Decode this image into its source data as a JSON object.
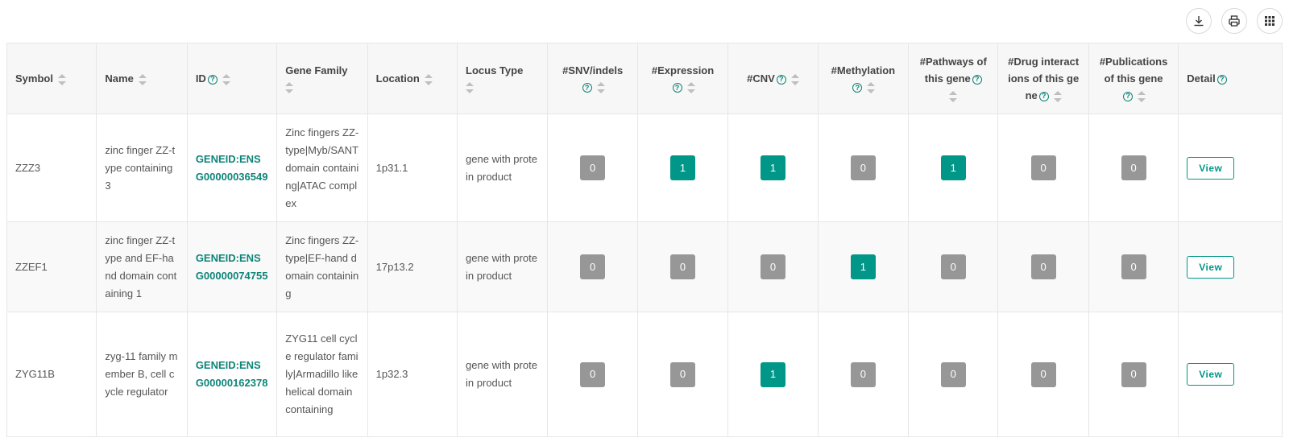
{
  "toolbar": {
    "buttons": [
      {
        "icon": "download-icon"
      },
      {
        "icon": "print-icon"
      },
      {
        "icon": "columns-grid-icon"
      }
    ]
  },
  "colors": {
    "accent": "#009688",
    "link": "#0e8478",
    "badge_zero": "#979797",
    "header_bg": "#f7f7f7"
  },
  "table": {
    "headers": [
      {
        "label": "Symbol",
        "help": false,
        "sortable": true
      },
      {
        "label": "Name",
        "help": false,
        "sortable": true
      },
      {
        "label": "ID",
        "help": true,
        "sortable": true
      },
      {
        "label": "Gene Family",
        "help": false,
        "sortable": true
      },
      {
        "label": "Location",
        "help": false,
        "sortable": true
      },
      {
        "label": "Locus Type",
        "help": false,
        "sortable": true
      },
      {
        "label": "#SNV/indels",
        "help": true,
        "sortable": true
      },
      {
        "label": "#Expression",
        "help": true,
        "sortable": true
      },
      {
        "label": "#CNV",
        "help": true,
        "sortable": true
      },
      {
        "label": "#Methylation",
        "help": true,
        "sortable": true
      },
      {
        "label": "#Pathways of this gene",
        "help": true,
        "sortable": true
      },
      {
        "label": "#Drug interactions of this gene",
        "help": true,
        "sortable": true
      },
      {
        "label": "#Publications of this gene",
        "help": true,
        "sortable": true
      },
      {
        "label": "Detail",
        "help": true,
        "sortable": false
      }
    ],
    "rows": [
      {
        "symbol": "ZZZ3",
        "name": "zinc finger ZZ-type containing 3",
        "id": "GENEID:ENSG00000036549",
        "gene_family": "Zinc fingers ZZ-type|Myb/SANT domain containing|ATAC complex",
        "location": "1p31.1",
        "locus_type": "gene with protein product",
        "snv_indels": "0",
        "expression": "1",
        "cnv": "1",
        "methylation": "0",
        "pathways": "1",
        "drug_interactions": "0",
        "publications": "0",
        "detail": "View"
      },
      {
        "symbol": "ZZEF1",
        "name": "zinc finger ZZ-type and EF-hand domain containing 1",
        "id": "GENEID:ENSG00000074755",
        "gene_family": "Zinc fingers ZZ-type|EF-hand domain containing",
        "location": "17p13.2",
        "locus_type": "gene with protein product",
        "snv_indels": "0",
        "expression": "0",
        "cnv": "0",
        "methylation": "1",
        "pathways": "0",
        "drug_interactions": "0",
        "publications": "0",
        "detail": "View"
      },
      {
        "symbol": "ZYG11B",
        "name": "zyg-11 family member B, cell cycle regulator",
        "id": "GENEID:ENSG00000162378",
        "gene_family": "ZYG11 cell cycle regulator family|Armadillo like helical domain containing",
        "location": "1p32.3",
        "locus_type": "gene with protein product",
        "snv_indels": "0",
        "expression": "0",
        "cnv": "1",
        "methylation": "0",
        "pathways": "0",
        "drug_interactions": "0",
        "publications": "0",
        "detail": "View"
      }
    ]
  }
}
